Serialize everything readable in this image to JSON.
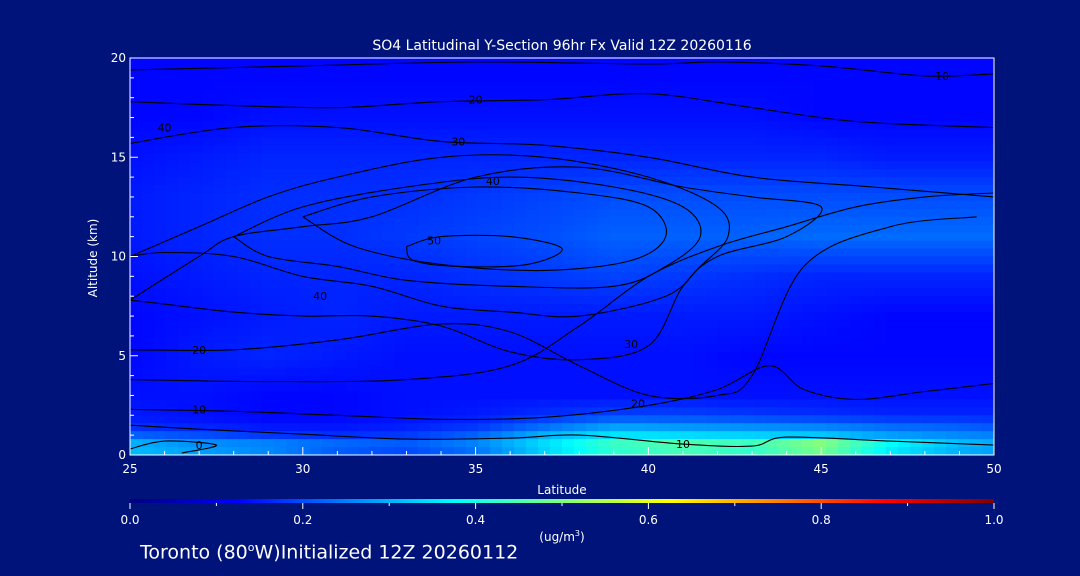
{
  "chart_data": {
    "type": "heatmap",
    "title": "SO4 Latitudinal Y-Section 96hr  Fx Valid 12Z 20260116",
    "xlabel": "Latitude",
    "ylabel": "Altitude (km)",
    "xlim": [
      25,
      50
    ],
    "ylim": [
      0,
      20
    ],
    "x_ticks": [
      "25",
      "30",
      "35",
      "40",
      "45",
      "50"
    ],
    "x_tick_values": [
      25,
      30,
      35,
      40,
      45,
      50
    ],
    "y_ticks": [
      "0",
      "5",
      "10",
      "15",
      "20"
    ],
    "y_tick_values": [
      0,
      5,
      10,
      15,
      20
    ],
    "background_color": "#00137a",
    "frame_color": "#ffffff",
    "contour_color": "#000000",
    "colorbar": {
      "ticks": [
        "0.0",
        "0.2",
        "0.4",
        "0.6",
        "0.8",
        "1.0"
      ],
      "tick_values": [
        0.0,
        0.2,
        0.4,
        0.6,
        0.8,
        1.0
      ],
      "unit": "(ug/m",
      "unit_sup": "3",
      "unit_close": ")",
      "colormap": [
        "#00007f",
        "#0000ff",
        "#0080ff",
        "#00ffff",
        "#80ff80",
        "#ffff00",
        "#ff8000",
        "#ff0000",
        "#7f0000"
      ]
    },
    "field": {
      "lat": [
        25,
        27,
        29,
        31,
        33,
        35,
        37,
        39,
        41,
        43,
        45,
        47,
        49,
        50
      ],
      "alt": [
        0,
        0.5,
        1,
        1.5,
        2,
        3,
        5,
        7,
        9,
        11,
        13,
        15,
        17,
        19,
        20
      ],
      "values": [
        [
          0.3,
          0.28,
          0.25,
          0.2,
          0.18,
          0.22,
          0.32,
          0.4,
          0.42,
          0.4,
          0.45,
          0.33,
          0.28,
          0.27
        ],
        [
          0.32,
          0.28,
          0.27,
          0.24,
          0.22,
          0.26,
          0.35,
          0.45,
          0.48,
          0.46,
          0.55,
          0.4,
          0.32,
          0.3
        ],
        [
          0.22,
          0.2,
          0.18,
          0.17,
          0.18,
          0.22,
          0.3,
          0.35,
          0.34,
          0.33,
          0.32,
          0.28,
          0.26,
          0.25
        ],
        [
          0.16,
          0.15,
          0.14,
          0.14,
          0.15,
          0.17,
          0.22,
          0.27,
          0.26,
          0.25,
          0.24,
          0.22,
          0.21,
          0.2
        ],
        [
          0.15,
          0.14,
          0.13,
          0.13,
          0.14,
          0.15,
          0.17,
          0.19,
          0.19,
          0.18,
          0.17,
          0.16,
          0.16,
          0.16
        ],
        [
          0.14,
          0.14,
          0.13,
          0.13,
          0.14,
          0.14,
          0.14,
          0.14,
          0.14,
          0.14,
          0.14,
          0.14,
          0.14,
          0.14
        ],
        [
          0.13,
          0.15,
          0.16,
          0.15,
          0.14,
          0.14,
          0.14,
          0.14,
          0.14,
          0.13,
          0.13,
          0.13,
          0.13,
          0.13
        ],
        [
          0.13,
          0.14,
          0.15,
          0.16,
          0.15,
          0.15,
          0.15,
          0.15,
          0.15,
          0.15,
          0.14,
          0.13,
          0.13,
          0.13
        ],
        [
          0.14,
          0.15,
          0.16,
          0.16,
          0.16,
          0.17,
          0.18,
          0.19,
          0.18,
          0.17,
          0.16,
          0.16,
          0.16,
          0.16
        ],
        [
          0.15,
          0.16,
          0.17,
          0.17,
          0.18,
          0.19,
          0.2,
          0.22,
          0.22,
          0.22,
          0.23,
          0.23,
          0.23,
          0.23
        ],
        [
          0.15,
          0.16,
          0.17,
          0.17,
          0.17,
          0.18,
          0.19,
          0.2,
          0.2,
          0.2,
          0.2,
          0.2,
          0.2,
          0.2
        ],
        [
          0.14,
          0.15,
          0.16,
          0.16,
          0.16,
          0.16,
          0.16,
          0.16,
          0.16,
          0.16,
          0.16,
          0.15,
          0.15,
          0.15
        ],
        [
          0.13,
          0.13,
          0.14,
          0.14,
          0.14,
          0.14,
          0.14,
          0.14,
          0.14,
          0.14,
          0.13,
          0.13,
          0.13,
          0.13
        ],
        [
          0.13,
          0.13,
          0.13,
          0.13,
          0.13,
          0.13,
          0.13,
          0.13,
          0.13,
          0.13,
          0.13,
          0.13,
          0.13,
          0.13
        ],
        [
          0.13,
          0.13,
          0.13,
          0.13,
          0.13,
          0.13,
          0.13,
          0.13,
          0.13,
          0.13,
          0.13,
          0.13,
          0.13,
          0.13
        ]
      ]
    },
    "contours": [
      {
        "label": "0",
        "label_at": [
          27,
          0.5
        ],
        "points": [
          [
            25,
            0.3
          ],
          [
            26,
            0.7
          ],
          [
            27.5,
            0.5
          ],
          [
            26.5,
            0.1
          ]
        ]
      },
      {
        "label": "10",
        "label_at": [
          41,
          0.55
        ],
        "points": [
          [
            25,
            1.5
          ],
          [
            27,
            1.3
          ],
          [
            30,
            1.05
          ],
          [
            33,
            0.8
          ],
          [
            36,
            0.85
          ],
          [
            38,
            1.0
          ],
          [
            41,
            0.55
          ],
          [
            43,
            0.45
          ],
          [
            44,
            0.9
          ],
          [
            47,
            0.7
          ],
          [
            50,
            0.5
          ]
        ]
      },
      {
        "label": "10",
        "label_at": [
          27,
          2.3
        ],
        "points": [
          [
            25,
            2.3
          ],
          [
            28,
            2.2
          ],
          [
            31,
            2.0
          ],
          [
            34,
            1.8
          ],
          [
            37,
            1.9
          ],
          [
            40,
            2.5
          ],
          [
            42,
            3.3
          ],
          [
            43.5,
            4.5
          ],
          [
            44.5,
            3.3
          ],
          [
            46,
            2.8
          ],
          [
            48,
            3.2
          ],
          [
            50,
            3.6
          ]
        ]
      },
      {
        "label": "20",
        "label_at": [
          27,
          5.3
        ],
        "points": [
          [
            25,
            3.8
          ],
          [
            29,
            3.7
          ],
          [
            33,
            3.8
          ],
          [
            36,
            4.5
          ],
          [
            38,
            6.5
          ],
          [
            40,
            9.0
          ],
          [
            42,
            10.5
          ],
          [
            44,
            11.5
          ],
          [
            46,
            12.5
          ],
          [
            48,
            13.0
          ],
          [
            50,
            13.2
          ]
        ]
      },
      {
        "label": "20",
        "label_at": [
          39.7,
          2.6
        ],
        "points": [
          [
            25,
            5.3
          ],
          [
            28,
            5.3
          ],
          [
            31,
            5.8
          ],
          [
            34,
            6.6
          ],
          [
            36,
            6.2
          ],
          [
            38,
            4.5
          ],
          [
            40,
            3.0
          ],
          [
            42,
            3.0
          ],
          [
            43,
            4.0
          ],
          [
            44.5,
            9.5
          ],
          [
            47,
            11.5
          ],
          [
            49.5,
            12.0
          ]
        ]
      },
      {
        "label": "30",
        "label_at": [
          39.5,
          5.6
        ],
        "points": [
          [
            25,
            7.8
          ],
          [
            27,
            10.0
          ],
          [
            28,
            11.0
          ],
          [
            30,
            11.5
          ],
          [
            32,
            12.0
          ],
          [
            35,
            14.0
          ],
          [
            38,
            14.5
          ],
          [
            41,
            13.5
          ],
          [
            43,
            13.0
          ],
          [
            45,
            12.5
          ],
          [
            44,
            11.0
          ],
          [
            42,
            10.0
          ],
          [
            41,
            8.5
          ],
          [
            40,
            5.5
          ],
          [
            38,
            4.8
          ],
          [
            36,
            5.2
          ],
          [
            34,
            6.5
          ],
          [
            32,
            7.0
          ],
          [
            30,
            7.0
          ],
          [
            28,
            7.2
          ],
          [
            26,
            7.6
          ],
          [
            25,
            7.8
          ]
        ]
      },
      {
        "label": "40",
        "label_at": [
          26,
          16.5
        ],
        "points": [
          [
            25,
            10.0
          ],
          [
            27,
            11.5
          ],
          [
            29,
            13.0
          ],
          [
            31,
            14.0
          ],
          [
            34,
            15.0
          ],
          [
            37,
            15.0
          ],
          [
            40,
            14.0
          ],
          [
            42,
            12.5
          ],
          [
            42.3,
            11.0
          ],
          [
            41.5,
            9.5
          ],
          [
            40.5,
            8.0
          ],
          [
            38,
            7.0
          ],
          [
            36,
            7.2
          ],
          [
            34,
            7.5
          ],
          [
            32,
            8.5
          ],
          [
            30,
            9.0
          ],
          [
            28,
            10.0
          ],
          [
            26,
            10.2
          ],
          [
            25,
            10.0
          ]
        ]
      },
      {
        "label": "40",
        "label_at": [
          30.5,
          8.0
        ],
        "points": [
          [
            28,
            11.0
          ],
          [
            30,
            12.5
          ],
          [
            33,
            13.5
          ],
          [
            36,
            14.0
          ],
          [
            39,
            13.5
          ],
          [
            41,
            12.5
          ],
          [
            41.5,
            11.0
          ],
          [
            40.5,
            9.5
          ],
          [
            39,
            8.5
          ],
          [
            36,
            8.5
          ],
          [
            33,
            8.8
          ],
          [
            31,
            9.5
          ],
          [
            29,
            10.0
          ],
          [
            28,
            11.0
          ]
        ]
      },
      {
        "label": "40",
        "label_at": [
          35.5,
          13.8
        ],
        "points": [
          [
            30,
            12.0
          ],
          [
            32,
            13.0
          ],
          [
            35,
            13.5
          ],
          [
            38,
            13.2
          ],
          [
            40,
            12.5
          ],
          [
            40.5,
            11.0
          ],
          [
            39.5,
            9.8
          ],
          [
            37,
            9.3
          ],
          [
            34,
            9.6
          ],
          [
            31.5,
            10.5
          ],
          [
            30,
            12.0
          ]
        ]
      },
      {
        "label": "50",
        "label_at": [
          33.8,
          10.8
        ],
        "points": [
          [
            33,
            10.5
          ],
          [
            34,
            11.0
          ],
          [
            36,
            11.0
          ],
          [
            37.5,
            10.4
          ],
          [
            36.5,
            9.6
          ],
          [
            34.5,
            9.5
          ],
          [
            33.2,
            9.8
          ],
          [
            33,
            10.5
          ]
        ]
      },
      {
        "label": "30",
        "label_at": [
          34.5,
          15.8
        ],
        "points": [
          [
            25,
            15.7
          ],
          [
            28,
            16.5
          ],
          [
            31,
            16.5
          ],
          [
            34,
            15.8
          ],
          [
            37,
            15.6
          ],
          [
            40,
            15.0
          ],
          [
            43,
            14.0
          ],
          [
            46.5,
            13.5
          ],
          [
            50,
            13.0
          ]
        ]
      },
      {
        "label": "20",
        "label_at": [
          35,
          17.9
        ],
        "points": [
          [
            25,
            17.8
          ],
          [
            28,
            17.6
          ],
          [
            31,
            17.5
          ],
          [
            34,
            17.8
          ],
          [
            37,
            17.9
          ],
          [
            40,
            18.2
          ],
          [
            43,
            17.5
          ],
          [
            46,
            16.8
          ],
          [
            50,
            16.5
          ]
        ]
      },
      {
        "label": "10",
        "label_at": [
          48.5,
          19.1
        ],
        "points": [
          [
            25,
            19.4
          ],
          [
            30,
            19.6
          ],
          [
            35,
            19.8
          ],
          [
            40,
            19.7
          ],
          [
            42,
            19.8
          ],
          [
            45,
            19.6
          ],
          [
            48,
            19.1
          ],
          [
            50,
            19.2
          ]
        ]
      }
    ]
  },
  "footer": {
    "text_before": "Toronto (80",
    "degree": "o",
    "text_after": "W)Initialized 12Z 20260112"
  }
}
